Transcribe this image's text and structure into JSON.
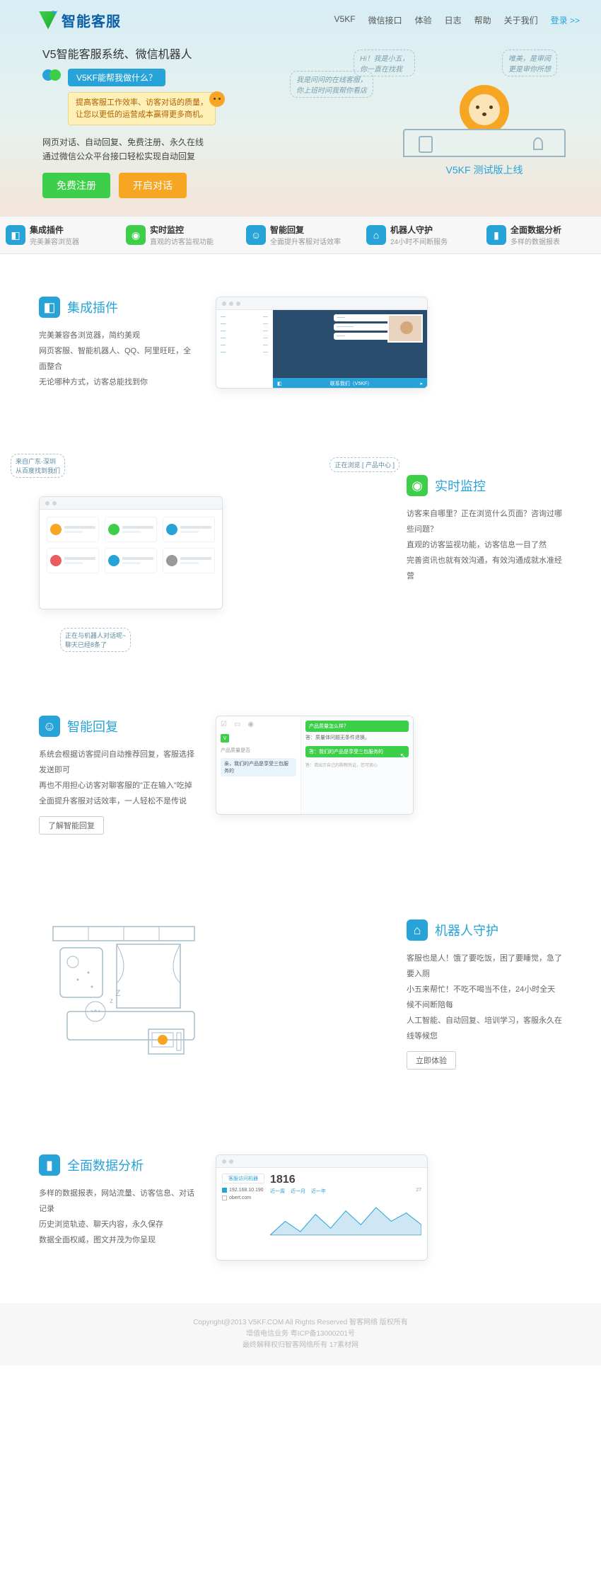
{
  "logo": "智能客服",
  "nav": [
    "V5KF",
    "微信接口",
    "体验",
    "日志",
    "帮助",
    "关于我们"
  ],
  "nav_login": "登录 >>",
  "hero": {
    "title": "V5智能客服系统、微信机器人",
    "bubble_blue": "V5KF能帮我做什么？",
    "bubble_yellow": "提高客服工作效率、访客对话的质量，\n让您以更低的运营成本赢得更多商机。",
    "sub1": "网页对话、自动回复、免费注册、永久在线",
    "sub2": "通过微信公众平台接口轻松实现自动回复",
    "btn_green": "免费注册",
    "btn_orange": "开启对话",
    "hand1": "Hi！我是小五，\n你一直在找我",
    "hand2": "我是问问的在线客服，\n你上班时间我帮你看店",
    "hand3": "唯美，是审阅\n更是审你所想",
    "beta": "V5KF 测试版上线"
  },
  "strip": [
    {
      "t": "集成插件",
      "s": "完美兼容浏览器"
    },
    {
      "t": "实时监控",
      "s": "直观的访客监视功能"
    },
    {
      "t": "智能回复",
      "s": "全面提升客服对话效率"
    },
    {
      "t": "机器人守护",
      "s": "24小时不间断服务"
    },
    {
      "t": "全面数据分析",
      "s": "多样的数据报表"
    }
  ],
  "sec1": {
    "title": "集成插件",
    "body": "完美兼容各浏览器，简约美观\n网页客服、智能机器人、QQ、阿里旺旺，全面整合\n无论哪种方式，访客总能找到你",
    "mock_strip": "联系我们（V5KF）"
  },
  "sec2": {
    "title": "实时监控",
    "body": "访客来自哪里？正在浏览什么页面？咨询过哪些问题？\n直观的访客监视功能，访客信息一目了然\n完善资讯也就有效沟通，有效沟通成就水准经营",
    "co1": "来自广东·深圳\n从百度找到我们",
    "co2": "正在浏览 [ 产品中心 ]",
    "co3": "正在与机器人对话呢~\n聊天已经8条了"
  },
  "sec3": {
    "title": "智能回复",
    "body": "系统会根据访客提问自动推荐回复，客服选择发送即可\n再也不用担心访客对聊客服的\"正在输入\"吃掉\n全面提升客服对话效率，一人轻松不是传说",
    "btn": "了解智能回复",
    "mock": {
      "q": "产品质量怎么样？",
      "a1": "答：质量体问题无条件退换。",
      "a2": "答：我们的产品是享受三包服务的",
      "tail": "答：请出示自己的购物凭证，您可放心",
      "left_label": "产品质量是否",
      "left_bub": "亲，我们的产品是享受三包服务的"
    }
  },
  "sec4": {
    "title": "机器人守护",
    "body": "客服也是人！饿了要吃饭，困了要睡觉，急了要入厕\n小五来帮忙！不吃不喝当不住，24小时全天候不间断陪每\n人工智能、自动回复、培训学习，客服永久在线等候您",
    "btn": "立即体验"
  },
  "sec5": {
    "title": "全面数据分析",
    "body": "多样的数据报表，网站流量、访客信息、对话记录\n历史浏览轨迹、聊天内容，永久保存\n数据全面权威，图文并茂为你呈现",
    "mock": {
      "side_title": "客服访问机器",
      "big": "1816",
      "filters": [
        "近一周",
        "近一月",
        "近一年",
        "27"
      ],
      "checks": [
        "192.168.10.190",
        "obert.com"
      ]
    }
  },
  "footer": {
    "l1": "Copyright@2013 V5KF.COM All Rights Reserved 智客网络 版权所有",
    "l2": "增值电信业务 粤ICP备13000201号",
    "l3": "最终解释权归智客网络所有 17素材网"
  }
}
